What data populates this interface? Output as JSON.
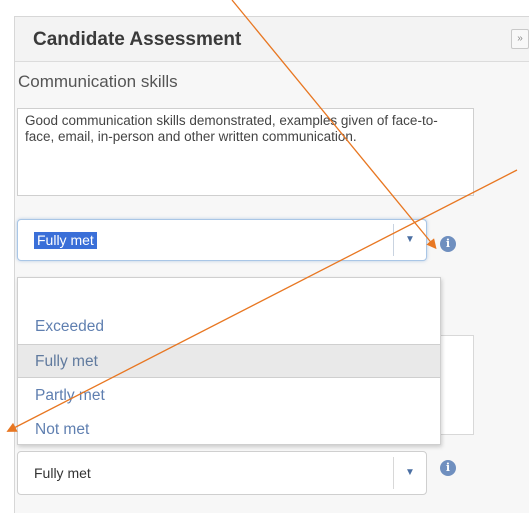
{
  "panel": {
    "title": "Candidate Assessment",
    "collapse_glyph": "»"
  },
  "section": {
    "label": "Communication skills",
    "comment": "Good communication skills demonstrated, examples given of face-to-face, email, in-person and other written communication."
  },
  "rating_select": {
    "value": "Fully met",
    "arrow_glyph": "▼",
    "options": [
      "Exceeded",
      "Fully met",
      "Partly met",
      "Not met"
    ],
    "highlighted_option": "Fully met"
  },
  "second_select": {
    "value": "Fully met",
    "arrow_glyph": "▼"
  },
  "info_glyph": "i",
  "colors": {
    "annotation_arrow": "#e87722",
    "selection_highlight": "#3a6fd8",
    "option_text": "#5f7fb0"
  }
}
